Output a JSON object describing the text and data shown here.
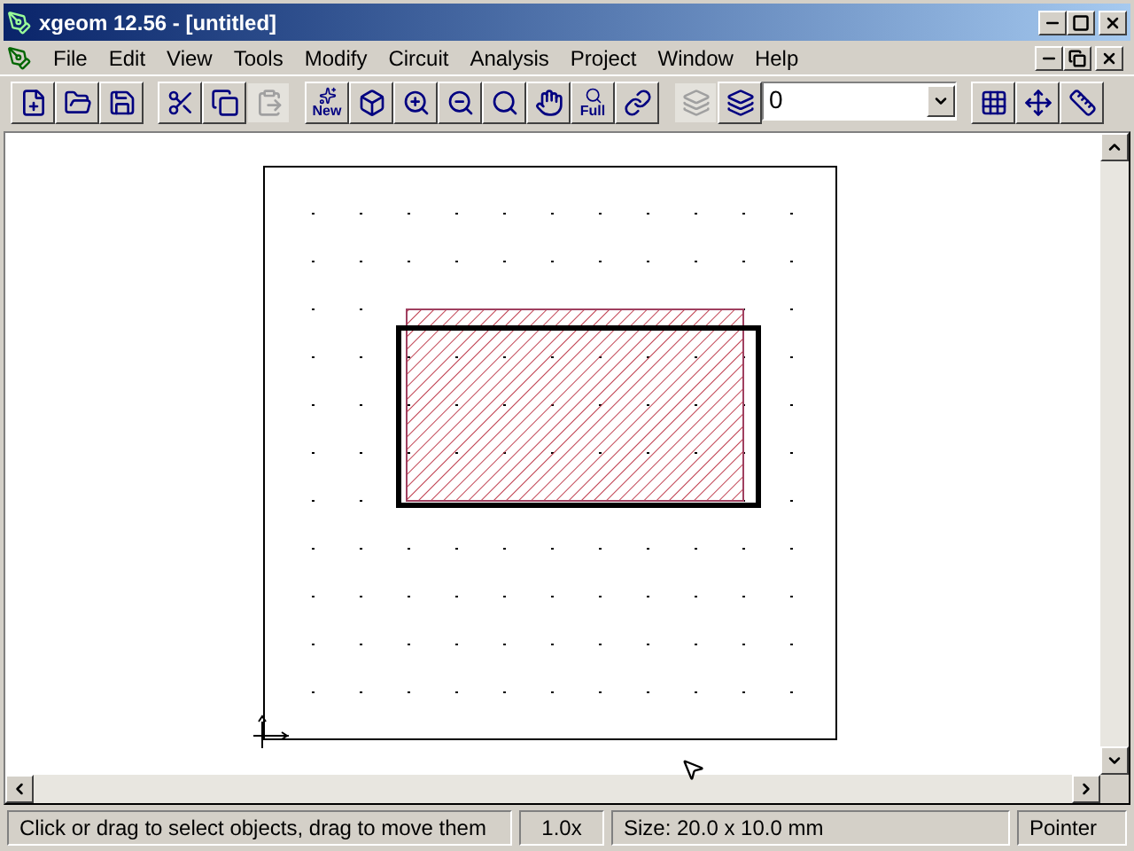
{
  "window": {
    "title": "xgeom 12.56 - [untitled]"
  },
  "menu": [
    "File",
    "Edit",
    "View",
    "Tools",
    "Modify",
    "Circuit",
    "Analysis",
    "Project",
    "Window",
    "Help"
  ],
  "toolbar": [
    [
      {
        "kind": "button",
        "disabled": false
      },
      {
        "kind": "button",
        "disabled": false
      },
      {
        "kind": "button",
        "disabled": false
      }
    ],
    [
      {
        "kind": "button",
        "disabled": false
      },
      {
        "kind": "button",
        "disabled": false
      },
      {
        "kind": "button",
        "disabled": true
      }
    ],
    [
      {
        "kind": "button",
        "disabled": false,
        "label": "New"
      },
      {
        "kind": "button",
        "disabled": false
      },
      {
        "kind": "button",
        "disabled": false
      },
      {
        "kind": "button",
        "disabled": false
      },
      {
        "kind": "button",
        "disabled": false
      },
      {
        "kind": "button",
        "disabled": false
      },
      {
        "kind": "button",
        "disabled": false,
        "label": "Full"
      },
      {
        "kind": "button",
        "disabled": false
      }
    ],
    [
      {
        "kind": "button",
        "disabled": true
      },
      {
        "kind": "button",
        "disabled": false
      },
      {
        "kind": "combo",
        "value": "0"
      }
    ],
    [
      {
        "kind": "button",
        "disabled": false
      },
      {
        "kind": "button",
        "disabled": false
      },
      {
        "kind": "button",
        "disabled": false
      }
    ]
  ],
  "status_bar": [
    "Click or drag to select objects, drag to move them",
    "1.0x",
    "Size: 20.0 x 10.0 mm",
    "Pointer"
  ]
}
